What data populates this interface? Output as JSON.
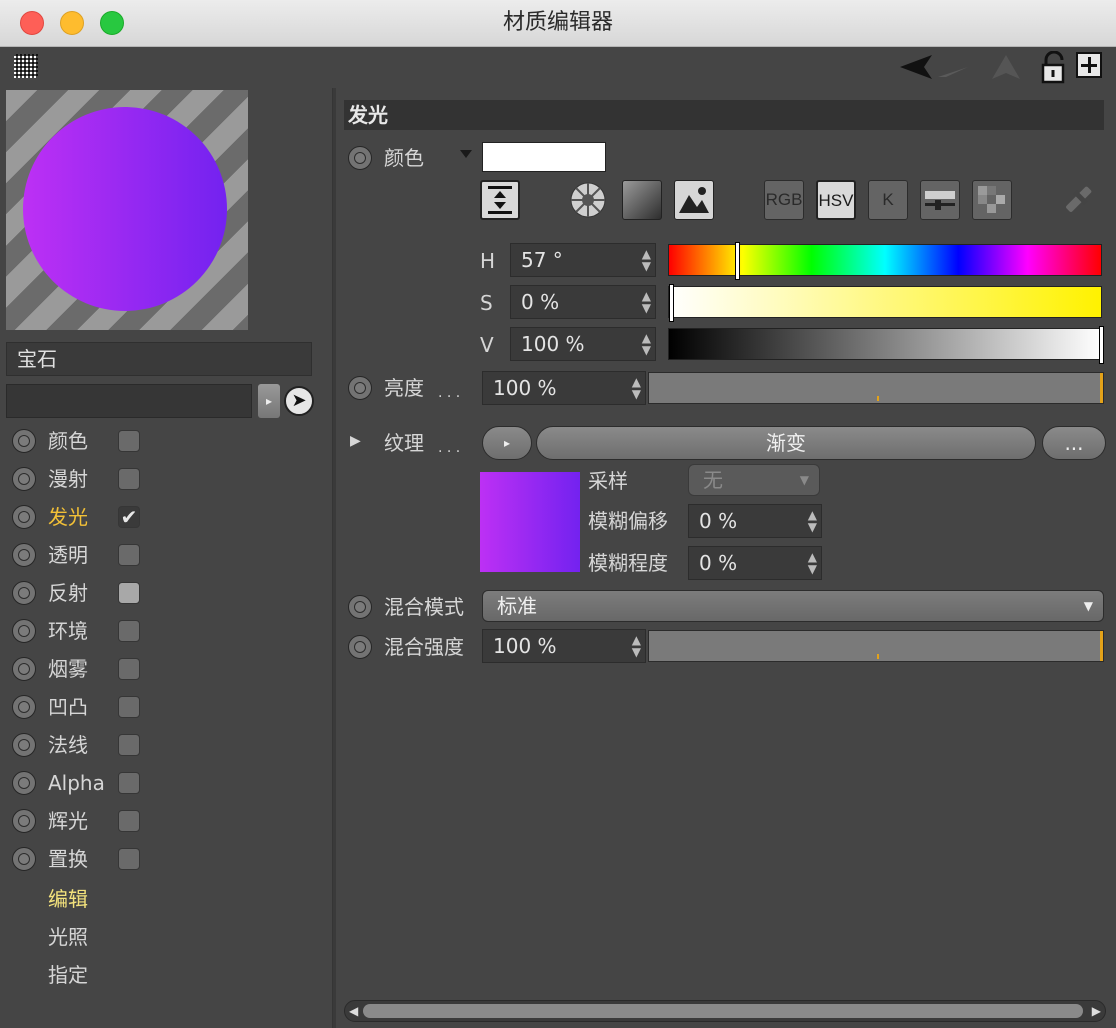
{
  "window": {
    "title": "材质编辑器"
  },
  "material": {
    "name": "宝石",
    "link_value": ""
  },
  "channels": [
    {
      "label": "颜色",
      "checked": false
    },
    {
      "label": "漫射",
      "checked": false
    },
    {
      "label": "发光",
      "checked": true
    },
    {
      "label": "透明",
      "checked": false
    },
    {
      "label": "反射",
      "checked": false
    },
    {
      "label": "环境",
      "checked": false
    },
    {
      "label": "烟雾",
      "checked": false
    },
    {
      "label": "凹凸",
      "checked": false
    },
    {
      "label": "法线",
      "checked": false
    },
    {
      "label": "Alpha",
      "checked": false
    },
    {
      "label": "辉光",
      "checked": false
    },
    {
      "label": "置换",
      "checked": false
    }
  ],
  "sub_links": [
    "编辑",
    "光照",
    "指定"
  ],
  "panel": {
    "section_title": "发光",
    "color_label": "颜色",
    "color_swatch": "#ffffff",
    "mode_buttons": [
      "RGB",
      "HSV",
      "K"
    ],
    "hsv": {
      "h_label": "H",
      "h_value": "57 °",
      "s_label": "S",
      "s_value": "0 %",
      "v_label": "V",
      "v_value": "100 %",
      "h_fraction": 0.158,
      "s_fraction": 0.0,
      "v_fraction": 1.0
    },
    "brightness_label": "亮度",
    "brightness_value": "100 %",
    "dots": ". . .",
    "texture_label": "纹理",
    "texture_name": "渐变",
    "texture_more": "...",
    "sampling_label": "采样",
    "sampling_value": "无",
    "blur_offset_label": "模糊偏移",
    "blur_offset_value": "0 %",
    "blur_scale_label": "模糊程度",
    "blur_scale_value": "0 %",
    "mix_mode_label": "混合模式",
    "mix_mode_value": "标准",
    "mix_strength_label": "混合强度",
    "mix_strength_value": "100 %"
  },
  "colors": {
    "accent_active": "#f2c037",
    "link_selected": "#f3e27c",
    "material_left": "#bd30f4",
    "material_right": "#7322f0"
  }
}
